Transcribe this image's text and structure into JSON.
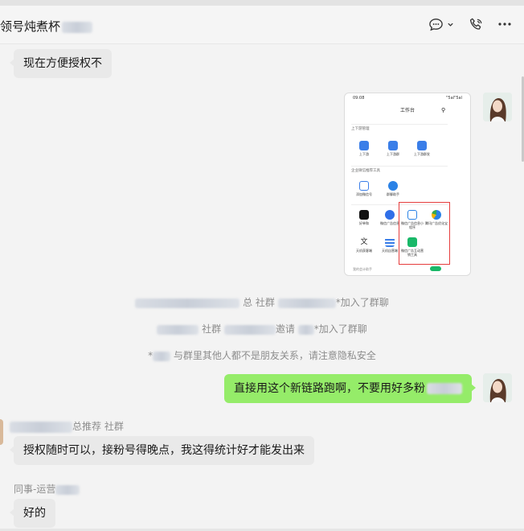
{
  "header": {
    "title": "领号炖煮杯",
    "icons": [
      "chat-bubble-icon",
      "chevron-down-icon",
      "phone-call-icon",
      "more-icon"
    ]
  },
  "messages": [
    {
      "side": "in",
      "text": "现在方便授权不"
    },
    {
      "side": "out",
      "type": "image"
    },
    {
      "side": "system",
      "text": "总 社群",
      "tail": "*加入了群聊"
    },
    {
      "side": "system",
      "text": "社群",
      "tail": "邀请",
      "tail2": "*加入了群聊"
    },
    {
      "side": "system",
      "text": "与群里其他人都不是朋友关系，请注意隐私安全",
      "head": "*"
    },
    {
      "side": "out",
      "text": "直接用这个新链路跑啊，不要用好多粉"
    },
    {
      "side": "in",
      "sender": "总推荐 社群",
      "text": "授权随时可以，接粉号得晚点，我这得统计好才能发出来"
    },
    {
      "side": "in",
      "sender": "同事-运营",
      "text": "好的"
    }
  ],
  "screenshot": {
    "status_time": "09:08",
    "status_right": "\"5al\"5al",
    "title": "工作台",
    "section1": "上下游管理",
    "apps1": [
      "上下游",
      "上下游群",
      "上下游群发"
    ],
    "section2": "企业微信推荐工具",
    "apps2": [
      "添加微信号",
      "群聊助手"
    ],
    "apps3": [
      "好单和",
      "微信广告信息",
      "微信广告信息小程序",
      "腾讯广告优化宝"
    ],
    "apps4": [
      "天机获客端",
      "天机自营端",
      "微信广告互动营销工具"
    ],
    "footer": "我的会计助手"
  }
}
